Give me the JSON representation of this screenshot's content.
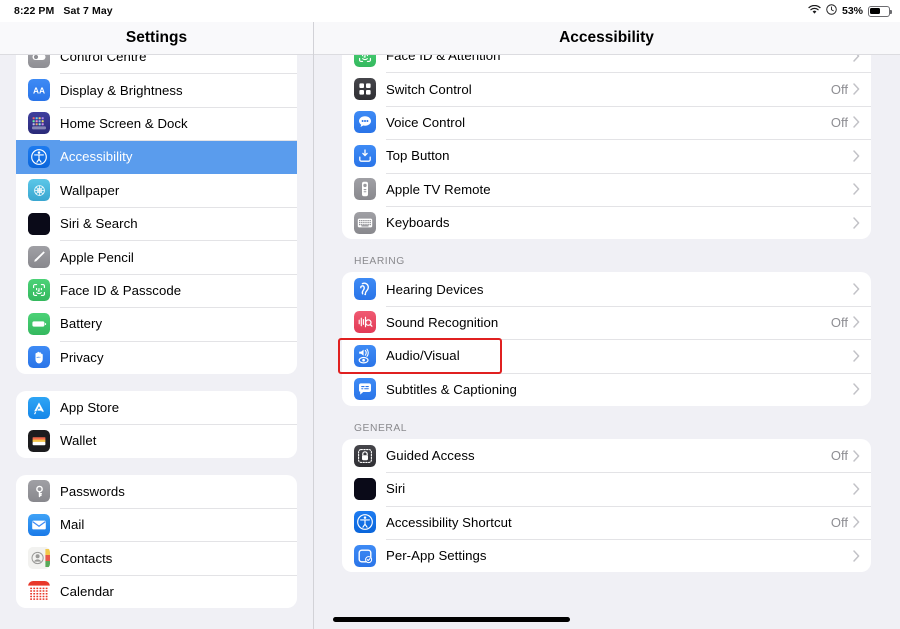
{
  "status_bar": {
    "time": "8:22 PM",
    "date": "Sat 7 May",
    "wifi_icon": "wifi-icon",
    "rotation_lock_icon": "rotation-lock-icon",
    "battery_percent": "53%",
    "battery_icon": "battery-icon"
  },
  "sidebar": {
    "title": "Settings",
    "groups": [
      {
        "items": [
          {
            "label": "Control Centre",
            "icon": "control-centre-icon",
            "selected": false,
            "partial": true
          },
          {
            "label": "Display & Brightness",
            "icon": "display-brightness-icon",
            "selected": false
          },
          {
            "label": "Home Screen & Dock",
            "icon": "home-screen-dock-icon",
            "selected": false
          },
          {
            "label": "Accessibility",
            "icon": "accessibility-icon",
            "selected": true
          },
          {
            "label": "Wallpaper",
            "icon": "wallpaper-icon",
            "selected": false
          },
          {
            "label": "Siri & Search",
            "icon": "siri-search-icon",
            "selected": false
          },
          {
            "label": "Apple Pencil",
            "icon": "apple-pencil-icon",
            "selected": false
          },
          {
            "label": "Face ID & Passcode",
            "icon": "face-id-icon",
            "selected": false
          },
          {
            "label": "Battery",
            "icon": "battery-settings-icon",
            "selected": false
          },
          {
            "label": "Privacy",
            "icon": "privacy-icon",
            "selected": false
          }
        ]
      },
      {
        "items": [
          {
            "label": "App Store",
            "icon": "app-store-icon",
            "selected": false
          },
          {
            "label": "Wallet",
            "icon": "wallet-icon",
            "selected": false
          }
        ]
      },
      {
        "items": [
          {
            "label": "Passwords",
            "icon": "passwords-icon",
            "selected": false
          },
          {
            "label": "Mail",
            "icon": "mail-icon",
            "selected": false
          },
          {
            "label": "Contacts",
            "icon": "contacts-icon",
            "selected": false
          },
          {
            "label": "Calendar",
            "icon": "calendar-icon",
            "selected": false
          }
        ]
      }
    ]
  },
  "detail": {
    "title": "Accessibility",
    "sections": [
      {
        "header": "",
        "items": [
          {
            "label": "Face ID & Attention",
            "icon": "face-id-attention-icon",
            "value": "",
            "partial": true
          },
          {
            "label": "Switch Control",
            "icon": "switch-control-icon",
            "value": "Off"
          },
          {
            "label": "Voice Control",
            "icon": "voice-control-icon",
            "value": "Off"
          },
          {
            "label": "Top Button",
            "icon": "top-button-icon",
            "value": ""
          },
          {
            "label": "Apple TV Remote",
            "icon": "apple-tv-remote-icon",
            "value": ""
          },
          {
            "label": "Keyboards",
            "icon": "keyboards-icon",
            "value": ""
          }
        ]
      },
      {
        "header": "HEARING",
        "items": [
          {
            "label": "Hearing Devices",
            "icon": "hearing-devices-icon",
            "value": ""
          },
          {
            "label": "Sound Recognition",
            "icon": "sound-recognition-icon",
            "value": "Off"
          },
          {
            "label": "Audio/Visual",
            "icon": "audio-visual-icon",
            "value": "",
            "highlighted": true
          },
          {
            "label": "Subtitles & Captioning",
            "icon": "subtitles-captioning-icon",
            "value": ""
          }
        ]
      },
      {
        "header": "GENERAL",
        "items": [
          {
            "label": "Guided Access",
            "icon": "guided-access-icon",
            "value": "Off"
          },
          {
            "label": "Siri",
            "icon": "siri-icon",
            "value": ""
          },
          {
            "label": "Accessibility Shortcut",
            "icon": "accessibility-shortcut-icon",
            "value": "Off"
          },
          {
            "label": "Per-App Settings",
            "icon": "per-app-settings-icon",
            "value": ""
          }
        ]
      }
    ]
  },
  "annotation": {
    "target_label": "Audio/Visual",
    "box_color": "#e02020"
  },
  "colors": {
    "selection_blue": "#5a9ced",
    "background": "#f0f0f5",
    "card": "#ffffff",
    "secondary_text": "#8e8e93"
  }
}
